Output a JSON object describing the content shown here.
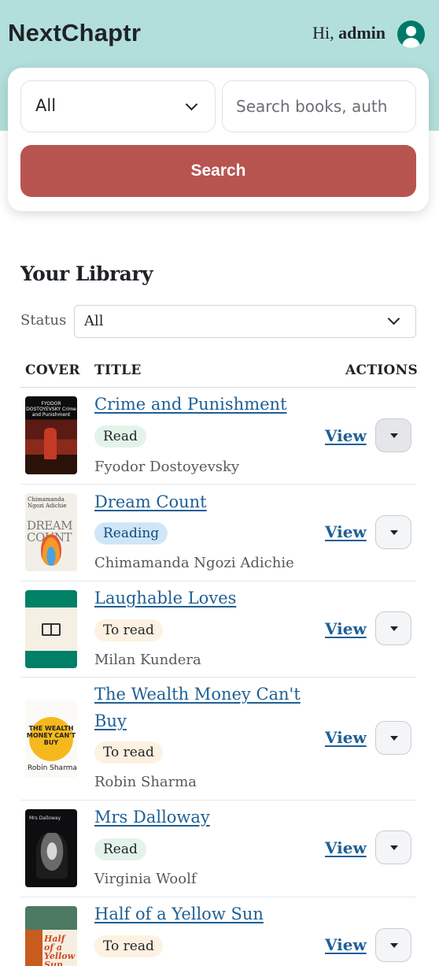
{
  "header": {
    "brand": "NextChaptr",
    "greeting": "Hi,",
    "username": "admin"
  },
  "search": {
    "category_value": "All",
    "placeholder": "Search books, auth",
    "button_label": "Search"
  },
  "library": {
    "title": "Your Library",
    "status_label": "Status",
    "status_value": "All",
    "columns": {
      "cover": "COVER",
      "title": "TITLE",
      "actions": "ACTIONS"
    },
    "view_label": "View",
    "books": [
      {
        "title": "Crime and Punishment",
        "status": "Read",
        "author": "Fyodor Dostoyevsky",
        "cover_text": "FYODOR DOSTOYEVSKY Crime and Punishment"
      },
      {
        "title": "Dream Count",
        "status": "Reading",
        "author": "Chimamanda Ngozi Adichie",
        "cover_text_1": "Chimamanda Ngozi Adichie",
        "cover_text_2": "DREAM COUNT"
      },
      {
        "title": "Laughable Loves",
        "status": "To read",
        "author": "Milan Kundera"
      },
      {
        "title": "The Wealth Money Can't Buy",
        "status": "To read",
        "author": "Robin Sharma",
        "cover_text_1": "THE WEALTH MONEY CAN'T BUY",
        "cover_text_2": "Robin Sharma"
      },
      {
        "title": "Mrs Dalloway",
        "status": "Read",
        "author": "Virginia Woolf",
        "cover_text": "Mrs Dalloway"
      },
      {
        "title": "Half of a Yellow Sun",
        "status": "To read",
        "author": "",
        "cover_text": "Half of a Yellow Sun"
      }
    ]
  },
  "colors": {
    "header_bg": "#b2dfdb",
    "accent_button": "#b85450",
    "link": "#1f5f95",
    "avatar": "#00796b"
  }
}
